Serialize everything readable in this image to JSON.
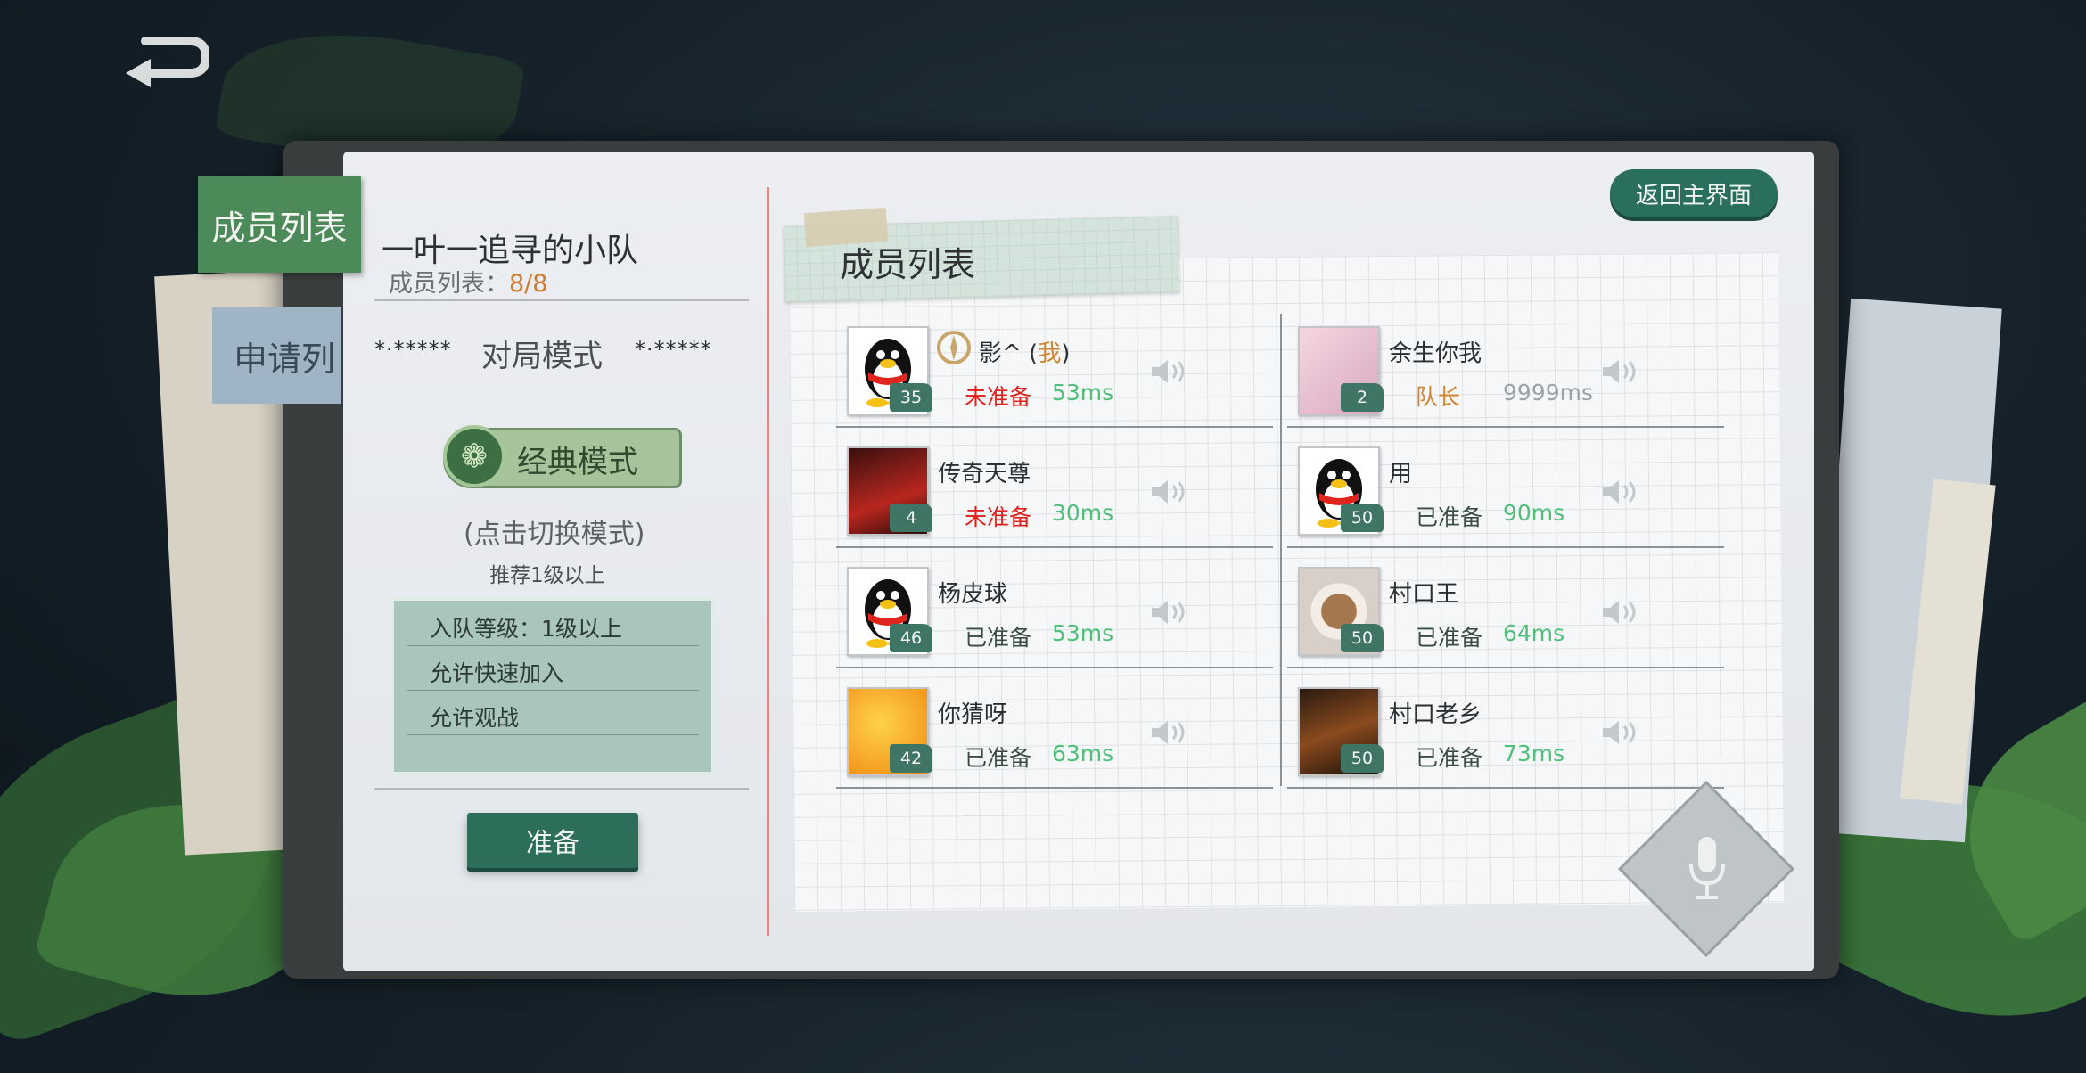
{
  "nav": {
    "back_icon": "return-arrow-icon"
  },
  "tabs": [
    {
      "label": "成员列表",
      "active": true
    },
    {
      "label": "申请列",
      "active": false
    }
  ],
  "team": {
    "name": "一叶一追寻的小队",
    "member_label": "成员列表：",
    "member_value": "8/8"
  },
  "mode_section": {
    "stars_left": "*·*****",
    "title": "对局模式",
    "stars_right": "*·*****",
    "current_mode": "经典模式",
    "switch_hint": "(点击切换模式)",
    "recommend": "推荐1级以上"
  },
  "settings": [
    "入队等级：1级以上",
    "允许快速加入",
    "允许观战"
  ],
  "ready_button": "准备",
  "return_button": "返回主界面",
  "list_title": "成员列表",
  "colors": {
    "not_ready": "#e0211b",
    "ready": "#3a4c44",
    "ping": "#4fbf7a",
    "captain": "#d3822d",
    "ping_gray": "#9aa2a6"
  },
  "members": [
    {
      "name": "影^ (",
      "me": "我",
      "name_end": ")",
      "level": "35",
      "status": "未准备",
      "status_type": "not_ready",
      "ping": "53ms",
      "avatar": "penguin",
      "badge": "compass-icon"
    },
    {
      "name": "余生你我",
      "level": "2",
      "status": "队长",
      "status_type": "captain",
      "ping": "9999ms",
      "avatar": "anime-girl"
    },
    {
      "name": "传奇天尊",
      "level": "4",
      "status": "未准备",
      "status_type": "not_ready",
      "ping": "30ms",
      "avatar": "red-hair-character"
    },
    {
      "name": "用",
      "level": "50",
      "status": "已准备",
      "status_type": "ready",
      "ping": "90ms",
      "avatar": "penguin"
    },
    {
      "name": "杨皮球",
      "level": "46",
      "status": "已准备",
      "status_type": "ready",
      "ping": "53ms",
      "avatar": "penguin"
    },
    {
      "name": "村口王",
      "level": "50",
      "status": "已准备",
      "status_type": "ready",
      "ping": "64ms",
      "avatar": "coffee-cup"
    },
    {
      "name": "你猜呀",
      "level": "42",
      "status": "已准备",
      "status_type": "ready",
      "ping": "63ms",
      "avatar": "orange-swirl"
    },
    {
      "name": "村口老乡",
      "level": "50",
      "status": "已准备",
      "status_type": "ready",
      "ping": "73ms",
      "avatar": "violin"
    }
  ],
  "mic_icon": "microphone-icon"
}
